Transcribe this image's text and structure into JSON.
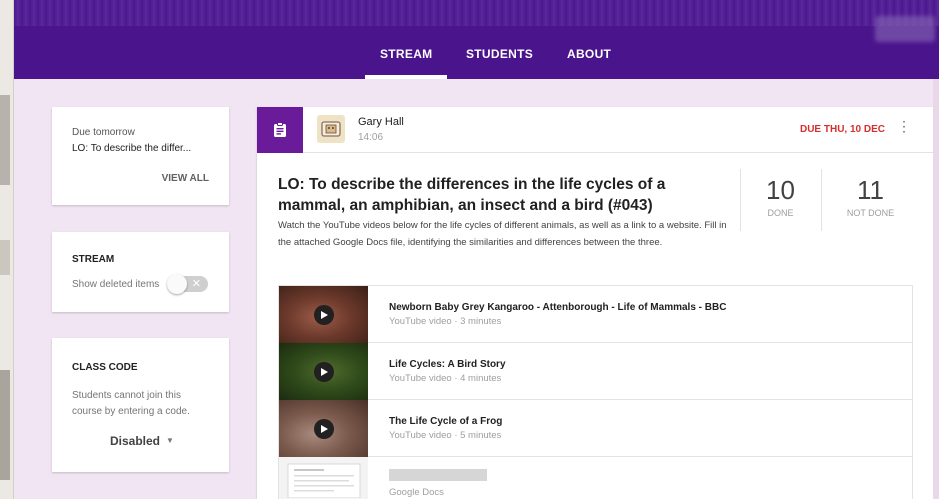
{
  "nav": {
    "tabs": [
      {
        "label": "STREAM",
        "active": true
      },
      {
        "label": "STUDENTS",
        "active": false
      },
      {
        "label": "ABOUT",
        "active": false
      }
    ]
  },
  "sidebar": {
    "due": {
      "heading": "Due tomorrow",
      "item": "LO: To describe the differ...",
      "view_all": "VIEW ALL"
    },
    "stream": {
      "heading": "STREAM",
      "toggle_label": "Show deleted items",
      "toggle_on": false
    },
    "class_code": {
      "heading": "CLASS CODE",
      "description": "Students cannot join this course by entering a code.",
      "status": "Disabled"
    }
  },
  "post": {
    "author": "Gary Hall",
    "time": "14:06",
    "due": "DUE THU, 10 DEC",
    "title": "LO: To describe the differences in the life cycles of a mammal, an amphibian, an insect and a bird (#043)",
    "description": "Watch the YouTube videos below for the life cycles of different animals, as well as a link to a website. Fill in the attached Google Docs file, identifying the similarities and differences between the three.",
    "counts": [
      {
        "value": "10",
        "label": "DONE"
      },
      {
        "value": "11",
        "label": "NOT DONE"
      }
    ],
    "materials": [
      {
        "title": "Newborn Baby Grey Kangaroo - Attenborough - Life of Mammals - BBC",
        "subtitle": "YouTube video · 3 minutes",
        "kind": "video"
      },
      {
        "title": "Life Cycles: A Bird Story",
        "subtitle": "YouTube video · 4 minutes",
        "kind": "video"
      },
      {
        "title": "The Life Cycle of a Frog",
        "subtitle": "YouTube video · 5 minutes",
        "kind": "video"
      },
      {
        "title": "",
        "subtitle": "Google Docs",
        "kind": "doc"
      }
    ]
  },
  "colors": {
    "brand": "#4a148c",
    "accent": "#6a1b9a",
    "due": "#d32f2f",
    "background": "#f1e4f3"
  },
  "icons": {
    "assignment": "assignment-icon",
    "more": "more-vert-icon",
    "play": "play-icon",
    "dropdown": "caret-down-icon"
  }
}
